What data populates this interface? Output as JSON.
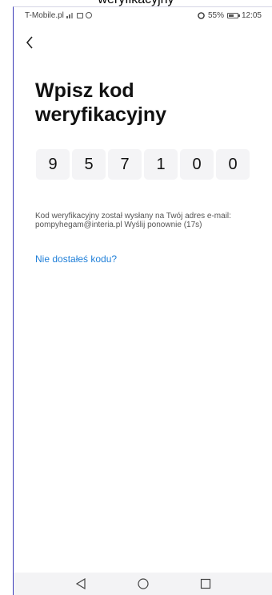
{
  "caption": "weryfikacyjny",
  "status_bar": {
    "carrier": "T-Mobile.pl",
    "battery": "55%",
    "time": "12:05"
  },
  "title": "Wpisz kod weryfikacyjny",
  "code_digits": [
    "9",
    "5",
    "7",
    "1",
    "0",
    "0"
  ],
  "info": {
    "message": "Kod weryfikacyjny został wysłany na Twój adres e-mail: pompyhegam@interia.pl",
    "resend": "Wyślij ponownie",
    "countdown": "(17s)"
  },
  "help_link": "Nie dostałeś kodu?",
  "icons": {
    "back": "chevron-left-icon",
    "nav_back": "triangle-back-icon",
    "nav_home": "circle-home-icon",
    "nav_recent": "square-recent-icon"
  },
  "colors": {
    "link": "#1f7fd8",
    "code_cell_bg": "#f4f4f6"
  }
}
